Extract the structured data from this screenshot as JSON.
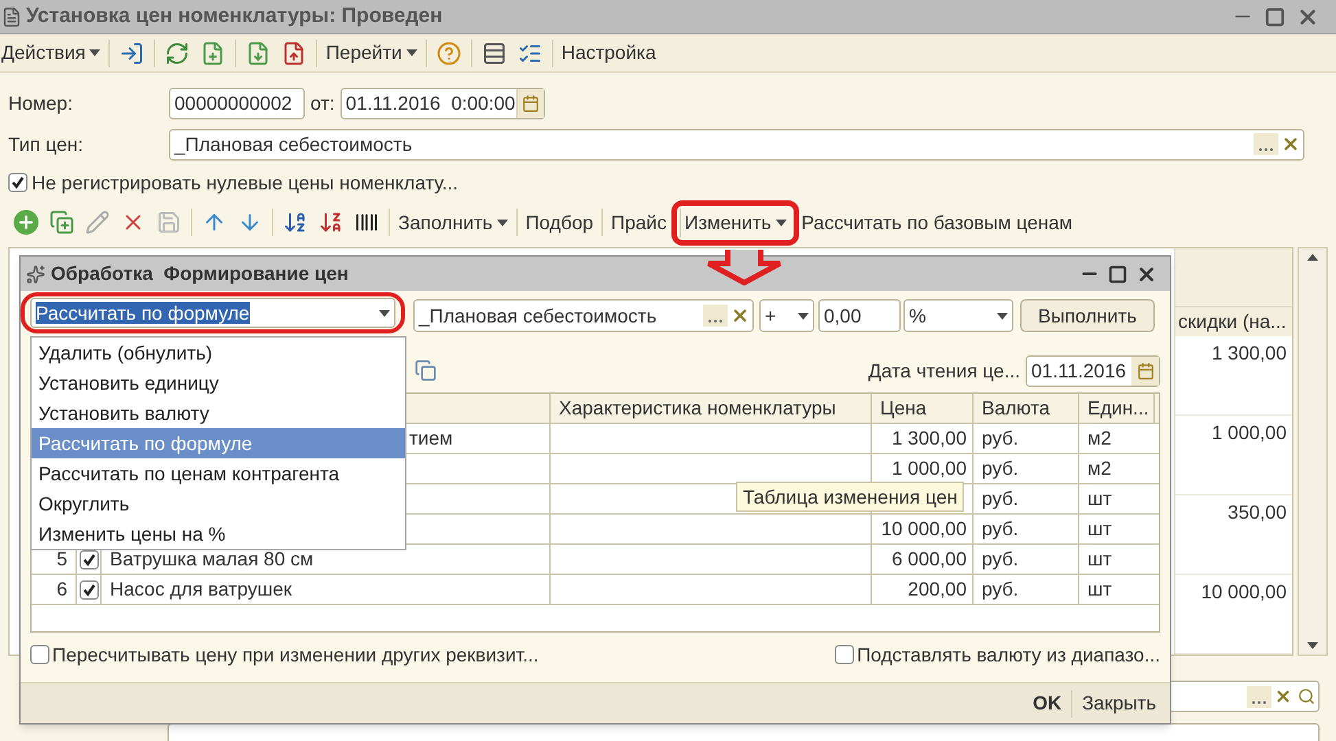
{
  "window": {
    "title": "Установка цен номенклатуры: Проведен"
  },
  "main_toolbar": {
    "actions_menu": "Действия",
    "goto_menu": "Перейти",
    "settings": "Настройка"
  },
  "form": {
    "number_label": "Номер:",
    "number": "00000000002",
    "date_label": "от:",
    "date": "01.11.2016  0:00:00",
    "price_type_label": "Тип цен:",
    "price_type": "_Плановая себестоимость",
    "zero_prices": {
      "label": "Не регистрировать нулевые цены номенклату...",
      "checked": true
    }
  },
  "table_toolbar": {
    "fill_menu": "Заполнить",
    "selection": "Подбор",
    "price_list": "Прайс",
    "change_menu": "Изменить",
    "calc_base": "Рассчитать по базовым ценам"
  },
  "background_table": {
    "column_header": "скидки (на...",
    "values": [
      "1 300,00",
      "1 000,00",
      "350,00",
      "10 000,00"
    ]
  },
  "dialog": {
    "title": "Обработка  Формирование цен",
    "action": "Рассчитать по формуле",
    "price_type": "_Плановая себестоимость",
    "operator": "+",
    "amount": "0,00",
    "unit": "%",
    "execute": "Выполнить",
    "date_label": "Дата чтения це...",
    "date": "01.11.2016",
    "columns": [
      "Характеристика номенклатуры",
      "Цена",
      "Валюта",
      "Един..."
    ],
    "rows": [
      {
        "name_tail": "тием",
        "price": "1 300,00",
        "currency": "руб.",
        "unit": "м2"
      },
      {
        "price": "1 000,00",
        "currency": "руб.",
        "unit": "м2"
      },
      {
        "currency": "руб.",
        "unit": "шт"
      },
      {
        "price": "10 000,00",
        "currency": "руб.",
        "unit": "шт"
      },
      {
        "number": "5",
        "checked": true,
        "name": "Ватрушка малая 80 см",
        "price": "6 000,00",
        "currency": "руб.",
        "unit": "шт"
      },
      {
        "number": "6",
        "checked": true,
        "name": "Насос для ватрушек",
        "price": "200,00",
        "currency": "руб.",
        "unit": "шт"
      }
    ],
    "options": [
      {
        "label": "Удалить (обнулить)",
        "selected": false
      },
      {
        "label": "Установить единицу",
        "selected": false
      },
      {
        "label": "Установить валюту",
        "selected": false
      },
      {
        "label": "Рассчитать по формуле",
        "selected": true
      },
      {
        "label": "Рассчитать по ценам контрагента",
        "selected": false
      },
      {
        "label": "Округлить",
        "selected": false
      },
      {
        "label": "Изменить цены на %",
        "selected": false
      }
    ],
    "tooltip": "Таблица изменения цен",
    "recalc": {
      "label": "Пересчитывать цену при изменении других реквизит...",
      "checked": false
    },
    "currency_range": {
      "label": "Подставлять валюту из диапазо...",
      "checked": false
    },
    "ok": "OK",
    "close": "Закрыть"
  }
}
